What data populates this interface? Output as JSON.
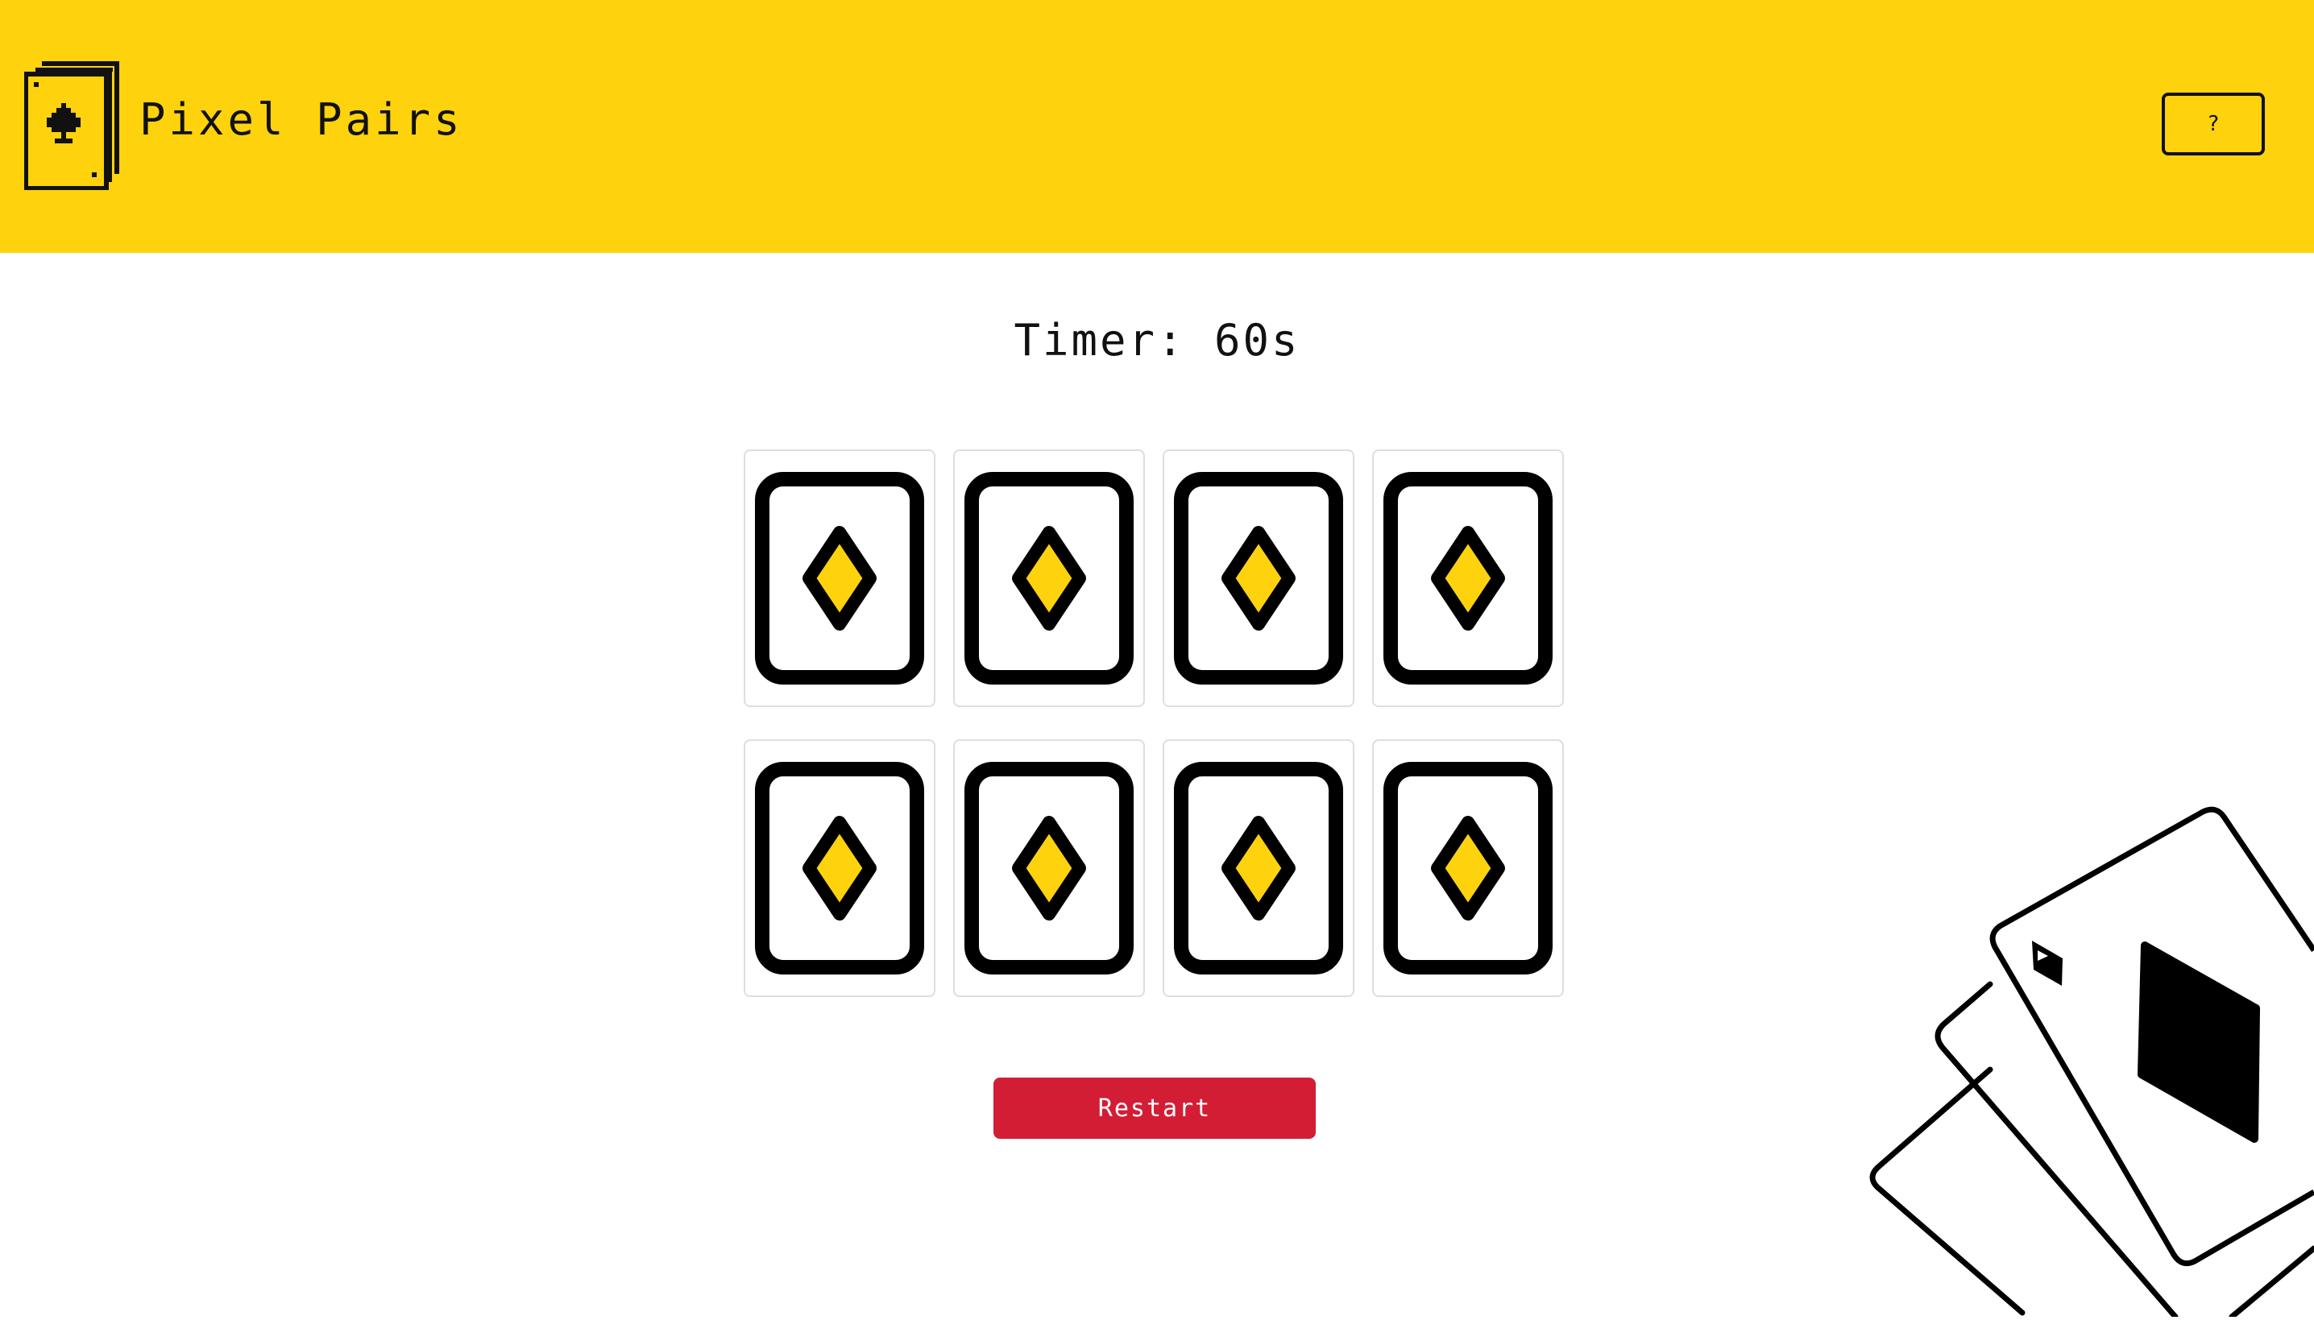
{
  "header": {
    "title": "Pixel Pairs",
    "logo_icon": "pixel-card-spade-icon",
    "help_label": "?",
    "background_color": "#fed20d"
  },
  "game": {
    "timer_text": "Timer: 60s",
    "restart_label": "Restart",
    "restart_color": "#d31d35",
    "cards": [
      {
        "state": "face-down",
        "back_icon": "diamond-card-back-icon"
      },
      {
        "state": "face-down",
        "back_icon": "diamond-card-back-icon"
      },
      {
        "state": "face-down",
        "back_icon": "diamond-card-back-icon"
      },
      {
        "state": "face-down",
        "back_icon": "diamond-card-back-icon"
      },
      {
        "state": "face-down",
        "back_icon": "diamond-card-back-icon"
      },
      {
        "state": "face-down",
        "back_icon": "diamond-card-back-icon"
      },
      {
        "state": "face-down",
        "back_icon": "diamond-card-back-icon"
      },
      {
        "state": "face-down",
        "back_icon": "diamond-card-back-icon"
      }
    ],
    "accent_color": "#fed20d"
  },
  "decoration": {
    "icon": "playing-cards-fan-icon"
  }
}
